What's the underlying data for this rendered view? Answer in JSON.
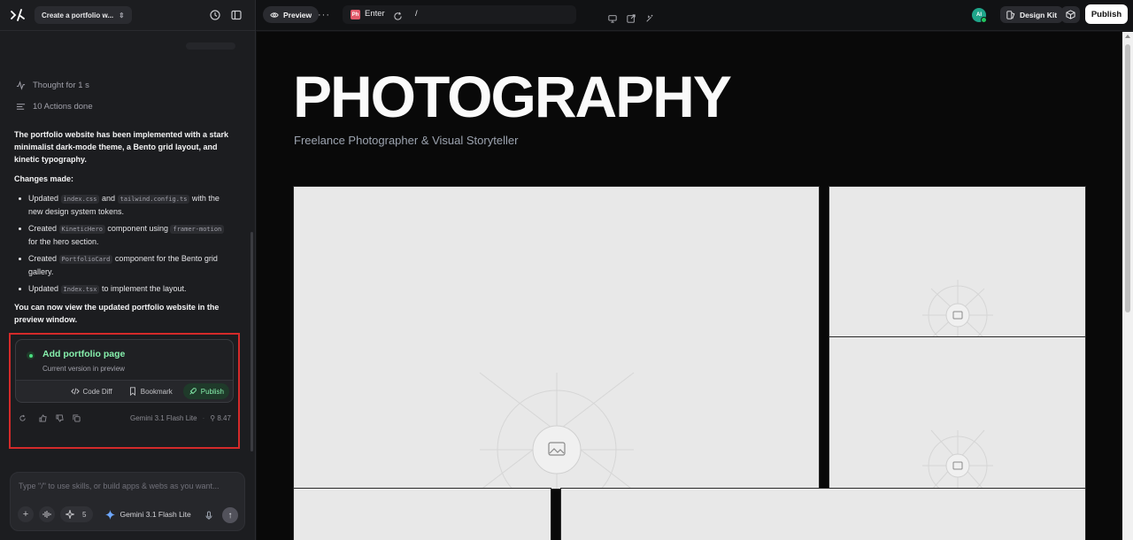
{
  "sidebar": {
    "project_name": "Create a portfolio w...",
    "thought_label": "Thought for 1 s",
    "actions_label": "10 Actions done",
    "summary": "The portfolio website has been implemented with a stark minimalist dark-mode theme, a Bento grid layout, and kinetic typography.",
    "changes_heading": "Changes made:",
    "changes": [
      {
        "pre": "Updated",
        "code1": "index.css",
        "mid": "and",
        "code2": "tailwind.config.ts",
        "post": "with the new design system tokens."
      },
      {
        "pre": "Created",
        "code1": "KineticHero",
        "mid": "component using",
        "code2": "framer-motion",
        "post": "for the hero section."
      },
      {
        "pre": "Created",
        "code1": "PortfolioCard",
        "mid": "component for the Bento grid gallery.",
        "code2": "",
        "post": ""
      },
      {
        "pre": "Updated",
        "code1": "Index.tsx",
        "mid": "to implement the layout.",
        "code2": "",
        "post": ""
      }
    ],
    "closing": "You can now view the updated portfolio website in the preview window.",
    "version_card": {
      "title": "Add portfolio page",
      "subtitle": "Current version in preview",
      "code_diff": "Code Diff",
      "bookmark": "Bookmark",
      "publish": "Publish"
    },
    "model_name": "Gemini 3.1 Flash Lite",
    "credits": "8.47",
    "input_placeholder": "Type \"/\" to use skills, or build apps & webs as you want...",
    "skills_count": "5",
    "composer_model": "Gemini 3.1 Flash Lite"
  },
  "topbar": {
    "preview_label": "Preview",
    "page_title": "Enter",
    "favicon_text": "Ph",
    "url_path": "/",
    "avatar_initials": "AI",
    "design_kit_label": "Design Kit",
    "publish_label": "Publish"
  },
  "preview": {
    "hero_title": "PHOTOGRAPHY",
    "tagline": "Freelance Photographer & Visual Storyteller"
  },
  "colors": {
    "accent_green": "#86efac",
    "highlight_red": "#d42a2a",
    "background": "#111214"
  },
  "icons": [
    "logo-icon",
    "history-icon",
    "sidebar-toggle-icon",
    "thought-icon",
    "actions-icon",
    "eye-icon",
    "refresh-icon",
    "monitor-icon",
    "external-link-icon",
    "magic-icon",
    "cube-icon",
    "image-placeholder-icon"
  ]
}
